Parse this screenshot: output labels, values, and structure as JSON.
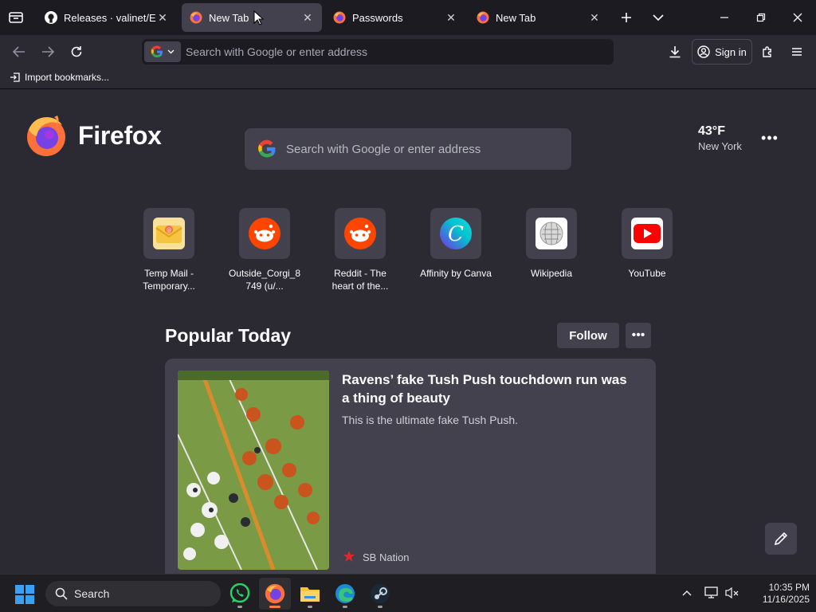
{
  "tabs": [
    {
      "title": "Releases · valinet/ExplorerPatcher",
      "favicon": "github-icon",
      "active": false
    },
    {
      "title": "New Tab",
      "favicon": "firefox-icon",
      "active": true
    },
    {
      "title": "Passwords",
      "favicon": "firefox-icon",
      "active": false
    },
    {
      "title": "New Tab",
      "favicon": "firefox-icon",
      "active": false
    }
  ],
  "urlbar": {
    "placeholder": "Search with Google or enter address",
    "engine": "google-icon"
  },
  "toolbar": {
    "sign_in_label": "Sign in"
  },
  "bookmarks": {
    "import_label": "Import bookmarks..."
  },
  "newtab": {
    "brand": "Firefox",
    "search_placeholder": "Search with Google or enter address",
    "weather": {
      "temp": "43°F",
      "city": "New York"
    },
    "shortcuts": [
      {
        "line1": "Temp Mail -",
        "line2": "Temporary...",
        "icon": "temp-mail-icon"
      },
      {
        "line1": "Outside_Corgi_8",
        "line2": "749 (u/...",
        "icon": "reddit-icon"
      },
      {
        "line1": "Reddit - The",
        "line2": "heart of the...",
        "icon": "reddit-icon"
      },
      {
        "line1": "Affinity by Canva",
        "line2": "",
        "icon": "canva-icon"
      },
      {
        "line1": "Wikipedia",
        "line2": "",
        "icon": "wikipedia-icon"
      },
      {
        "line1": "YouTube",
        "line2": "",
        "icon": "youtube-icon"
      }
    ],
    "popular": {
      "title": "Popular Today",
      "follow_label": "Follow",
      "story": {
        "headline": "Ravens’ fake Tush Push touchdown run was a thing of beauty",
        "excerpt": "This is the ultimate fake Tush Push.",
        "source": "SB Nation"
      }
    }
  },
  "taskbar": {
    "search_label": "Search",
    "apps": [
      "whatsapp-icon",
      "firefox-icon",
      "file-explorer-icon",
      "edge-icon",
      "steam-icon"
    ],
    "time": "10:35 PM",
    "date": "11/16/2025"
  },
  "colors": {
    "accent": "#ff7a4d",
    "tab_active": "#42414d",
    "background": "#2b2a33"
  }
}
